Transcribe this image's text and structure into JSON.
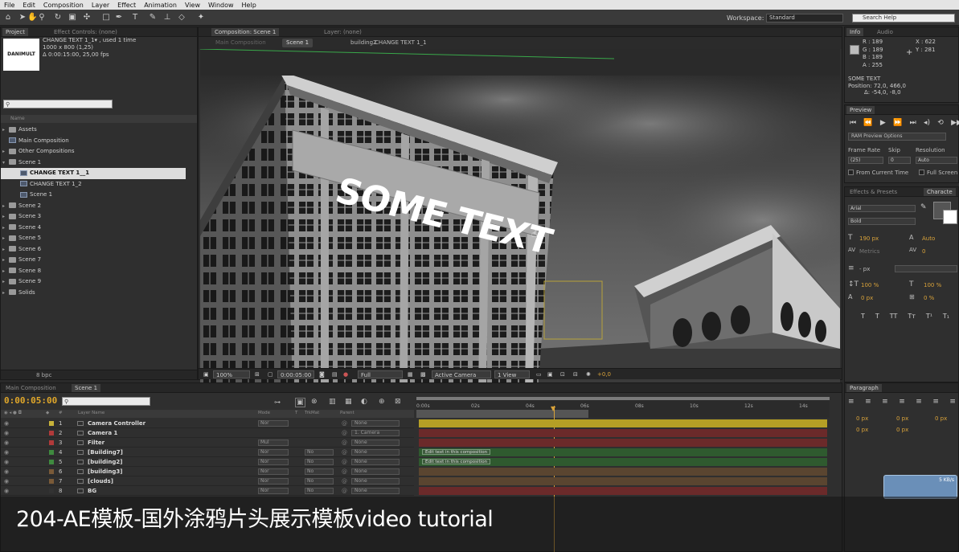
{
  "menu": [
    "File",
    "Edit",
    "Composition",
    "Layer",
    "Effect",
    "Animation",
    "View",
    "Window",
    "Help"
  ],
  "workspace": {
    "label": "Workspace:",
    "value": "Standard"
  },
  "search_help": "Search Help",
  "project": {
    "tabs": [
      "Project",
      "Effect Controls: (none)"
    ],
    "thumb_text": "DANIMULT",
    "selected_name": "CHANGE TEXT 1_1▾ , used 1 time",
    "size": "1000 x 800 (1,25)",
    "duration": "Δ 0:00:15:00, 25,00 fps",
    "column": "Name",
    "items": [
      {
        "name": "Assets",
        "type": "folder",
        "indent": 0
      },
      {
        "name": "Main Composition",
        "type": "comp",
        "indent": 0
      },
      {
        "name": "Other Compositions",
        "type": "folder",
        "indent": 0
      },
      {
        "name": "Scene 1",
        "type": "folder",
        "indent": 0
      },
      {
        "name": "CHANGE TEXT 1__1",
        "type": "comp",
        "indent": 1,
        "selected": true
      },
      {
        "name": "CHANGE TEXT 1_2",
        "type": "comp",
        "indent": 1
      },
      {
        "name": "Scene 1",
        "type": "comp",
        "indent": 1
      },
      {
        "name": "Scene 2",
        "type": "folder",
        "indent": 0
      },
      {
        "name": "Scene 3",
        "type": "folder",
        "indent": 0
      },
      {
        "name": "Scene 4",
        "type": "folder",
        "indent": 0
      },
      {
        "name": "Scene 5",
        "type": "folder",
        "indent": 0
      },
      {
        "name": "Scene 6",
        "type": "folder",
        "indent": 0
      },
      {
        "name": "Scene 7",
        "type": "folder",
        "indent": 0
      },
      {
        "name": "Scene 8",
        "type": "folder",
        "indent": 0
      },
      {
        "name": "Scene 9",
        "type": "folder",
        "indent": 0
      },
      {
        "name": "Solids",
        "type": "folder",
        "indent": 0
      }
    ],
    "bpc": "8 bpc"
  },
  "composition": {
    "tabs": [
      "Composition: Scene 1",
      "Layer: (none)"
    ],
    "breadcrumbs": [
      "Main Composition",
      "Scene 1",
      "building2",
      "CHANGE TEXT 1_1"
    ],
    "sign_text": "SOME TEXT",
    "zoom": "100%",
    "timecode": "0:00:05:00",
    "resolution": "Full",
    "camera": "Active Camera",
    "views": "1 View",
    "exposure": "+0,0"
  },
  "info": {
    "tabs": [
      "Info",
      "Audio"
    ],
    "r": "R : 189",
    "g": "G : 189",
    "b": "B : 189",
    "a": "A : 255",
    "x": "X : 622",
    "y": "Y : 281",
    "layer": "SOME TEXT",
    "position": "Position: 72,0, 466,0",
    "delta": "Δ: -54,0, -8,0"
  },
  "preview": {
    "tab": "Preview",
    "ram_options": "RAM Preview Options",
    "frame_rate_label": "Frame Rate",
    "skip_label": "Skip",
    "resolution_label": "Resolution",
    "frame_rate": "(25)",
    "skip": "0",
    "resolution": "Auto",
    "from_current": "From Current Time",
    "full_screen": "Full Screen"
  },
  "character": {
    "tabs": [
      "Effects & Presets",
      "Characte"
    ],
    "font": "Arial",
    "style": "Bold",
    "size": "190 px",
    "leading": "Auto",
    "kerning": "Metrics",
    "tracking": "0",
    "stroke": "- px",
    "vscale": "100 %",
    "hscale": "100 %",
    "baseline": "0 px",
    "tsume": "0 %",
    "styles": [
      "T",
      "T",
      "TT",
      "Tт",
      "T¹",
      "T₁"
    ]
  },
  "paragraph": {
    "tab": "Paragraph",
    "indents": [
      "0 px",
      "0 px",
      "0 px",
      "0 px",
      "0 px"
    ]
  },
  "network": "5 KB/s",
  "timeline": {
    "tabs": [
      "Main Composition",
      "Scene 1"
    ],
    "time": "0:00:05:00",
    "columns": [
      "#",
      "Layer Name",
      "Mode",
      "T",
      "TrkMat",
      "Parent"
    ],
    "ruler": [
      "0:00s",
      "02s",
      "04s",
      "06s",
      "08s",
      "10s",
      "12s",
      "14s"
    ],
    "layers": [
      {
        "num": "1",
        "name": "Camera Controller",
        "color": "#c8b33a",
        "mode": "Nor",
        "trk": "",
        "parent": "None",
        "bar": "#b59f25"
      },
      {
        "num": "2",
        "name": "Camera 1",
        "color": "#b13a3a",
        "mode": "",
        "trk": "",
        "parent": "1. Camera",
        "bar": "#6b2a2a"
      },
      {
        "num": "3",
        "name": "Filter",
        "color": "#b13a3a",
        "mode": "Mul",
        "trk": "",
        "parent": "None",
        "bar": "#6b2a2a"
      },
      {
        "num": "4",
        "name": "[Building7]",
        "color": "#3f8a3f",
        "mode": "Nor",
        "trk": "No",
        "parent": "None",
        "bar": "#2f5a2f",
        "note": "Edit text in this composition"
      },
      {
        "num": "5",
        "name": "[building2]",
        "color": "#3f8a3f",
        "mode": "Nor",
        "trk": "No",
        "parent": "None",
        "bar": "#2f5a2f",
        "note": "Edit text in this composition"
      },
      {
        "num": "6",
        "name": "[building3]",
        "color": "#7a5a38",
        "mode": "Nor",
        "trk": "No",
        "parent": "None",
        "bar": "#5a4530"
      },
      {
        "num": "7",
        "name": "[clouds]",
        "color": "#7a5a38",
        "mode": "Nor",
        "trk": "No",
        "parent": "None",
        "bar": "#5a4530"
      },
      {
        "num": "8",
        "name": "BG",
        "color": "#333333",
        "mode": "Nor",
        "trk": "No",
        "parent": "None",
        "bar": "#6b2a2a"
      }
    ]
  },
  "caption": "204-AE模板-国外涂鸦片头展示模板video tutorial"
}
